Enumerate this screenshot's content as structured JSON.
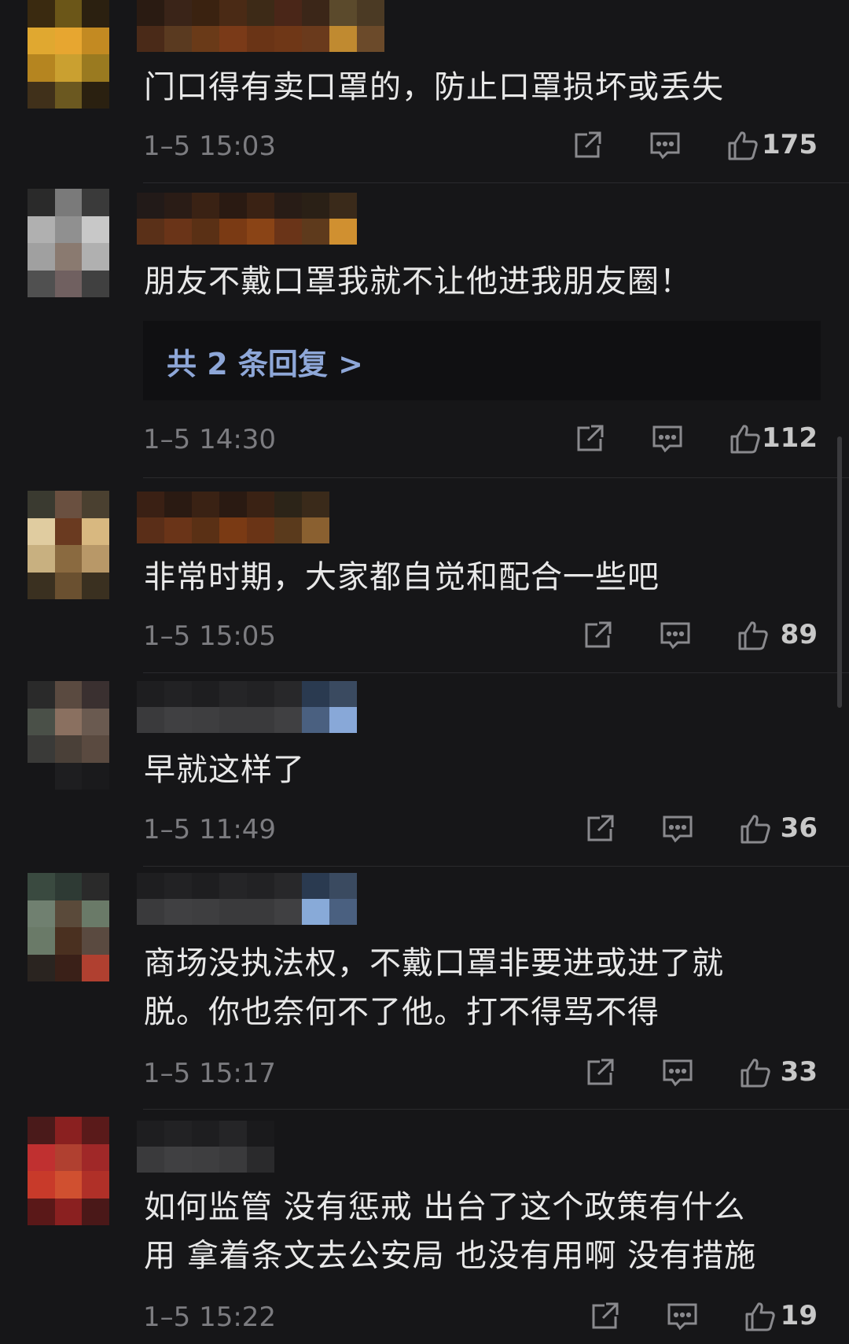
{
  "comments": [
    {
      "text": "门口得有卖口罩的，防止口罩损坏或丢失",
      "time": "1–5 15:03",
      "likes": "175",
      "avatar_colors": [
        "#3a2a10",
        "#6b5618",
        "#2b2010",
        "#e0a830",
        "#e7a630",
        "#c38a22",
        "#b58520",
        "#caa030",
        "#9a7a20",
        "#40301a",
        "#6b5820",
        "#2a2010"
      ],
      "username_colors": [
        "#2a1b12",
        "#4a2a18",
        "#3a2418",
        "#5a3a20",
        "#3a2210",
        "#6a3a18",
        "#4a2a15",
        "#7a3a18",
        "#3d2a17",
        "#6a3416",
        "#4a2618",
        "#6f3717",
        "#3b2618",
        "#6a3a1c",
        "#5b4a2c",
        "#c08a30",
        "#4b3a24",
        "#6b4a2a"
      ]
    },
    {
      "text": "朋友不戴口罩我就不让他进我朋友圈！",
      "replies_label": "共 2 条回复 >",
      "time": "1–5 14:30",
      "likes": "112",
      "avatar_colors": [
        "#2a2a2a",
        "#7a7a7a",
        "#3a3a3a",
        "#b0b0b0",
        "#909090",
        "#c8c8c8",
        "#a0a0a0",
        "#8a7a70",
        "#b0b0b0",
        "#505050",
        "#706060",
        "#404040"
      ],
      "username_colors": [
        "#221a18",
        "#5a3018",
        "#2a1c16",
        "#6a3418",
        "#3a2214",
        "#5a3015",
        "#2a1a12",
        "#7a3a14",
        "#3a2214",
        "#8a4416",
        "#281c16",
        "#6a3418",
        "#2a2016",
        "#5e3a1c",
        "#3a2a1a",
        "#d09030"
      ]
    },
    {
      "text": "非常时期，大家都自觉和配合一些吧",
      "time": "1–5 15:05",
      "likes": "89",
      "avatar_colors": [
        "#3a3a30",
        "#6a5040",
        "#4a4030",
        "#e0cca0",
        "#6a3a20",
        "#d8b880",
        "#c8b080",
        "#8a6a40",
        "#b89868",
        "#3a3020",
        "#6a5030",
        "#3a3020"
      ],
      "username_colors": [
        "#3a2014",
        "#5a2e18",
        "#2a1a12",
        "#6a3418",
        "#3a2214",
        "#5a3015",
        "#2a1a12",
        "#7a3a14",
        "#3a2214",
        "#6a3416",
        "#2c2418",
        "#5a3a1c",
        "#3a2a1a",
        "#8a6030"
      ]
    },
    {
      "text": "早就这样了",
      "time": "1–5 11:49",
      "likes": "36",
      "avatar_colors": [
        "#2a2a2a",
        "#5a4a40",
        "#3a3030",
        "#4a5048",
        "#8a7060",
        "#6a5a50",
        "#3a3a38",
        "#4a4038",
        "#5a4a40",
        "#161618",
        "#1e1e20",
        "#1a1a1c"
      ],
      "username_colors": [
        "#1e1e20",
        "#3a3a3c",
        "#222224",
        "#404042",
        "#1e1e20",
        "#3e3e40",
        "#252527",
        "#3a3a3c",
        "#222224",
        "#3a3a3c",
        "#28282a",
        "#404042",
        "#2a3a50",
        "#4a6080",
        "#3a4a60",
        "#88a8d8"
      ]
    },
    {
      "text_lines": [
        "商场没执法权，不戴口罩非要进或进了就",
        "脱。你也奈何不了他。打不得骂不得"
      ],
      "time": "1–5 15:17",
      "likes": "33",
      "avatar_colors": [
        "#3a4a40",
        "#2e3a34",
        "#2a2a2a",
        "#708070",
        "#5a4a3a",
        "#6a7a68",
        "#6a7a68",
        "#4a3020",
        "#5a4a40",
        "#2a2420",
        "#3a2018",
        "#b04030"
      ],
      "username_colors": [
        "#1e1e20",
        "#3a3a3c",
        "#222224",
        "#404042",
        "#1e1e20",
        "#3e3e40",
        "#252527",
        "#3a3a3c",
        "#222224",
        "#3a3a3c",
        "#28282a",
        "#404042",
        "#2a3a50",
        "#88aad8",
        "#3a4a60",
        "#4a6080"
      ]
    },
    {
      "text_lines": [
        "如何监管 没有惩戒 出台了这个政策有什么",
        "用 拿着条文去公安局 也没有用啊 没有措施"
      ],
      "time": "1–5 15:22",
      "likes": "19",
      "avatar_colors": [
        "#4a1a1a",
        "#8a2020",
        "#5a1a1a",
        "#c03030",
        "#b04030",
        "#a02828",
        "#c83a2a",
        "#d05030",
        "#b03028",
        "#5a1818",
        "#8a2020",
        "#4a1818"
      ],
      "username_colors": [
        "#1e1e20",
        "#3a3a3c",
        "#222224",
        "#404042",
        "#1e1e20",
        "#3e3e40",
        "#252527",
        "#3a3a3c",
        "#1a1a1c",
        "#2a2a2c"
      ]
    }
  ],
  "icons": {
    "share": "share-icon",
    "comment": "comment-icon",
    "like": "thumbs-up-icon"
  }
}
